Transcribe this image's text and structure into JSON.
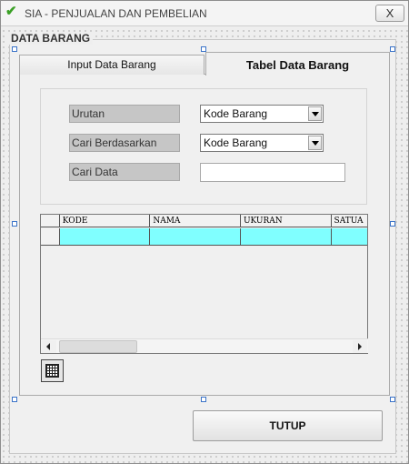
{
  "window": {
    "title": "SIA - PENJUALAN DAN PEMBELIAN",
    "title_icon": "checkmark-icon",
    "close_label": "X"
  },
  "frame": {
    "legend": "DATA BARANG"
  },
  "tabs": [
    {
      "label": "Input Data Barang",
      "selected": false
    },
    {
      "label": "Tabel Data Barang",
      "selected": true
    }
  ],
  "criteria": {
    "urutan_label": "Urutan",
    "urutan_value": "Kode Barang",
    "cari_berdasarkan_label": "Cari Berdasarkan",
    "cari_berdasarkan_value": "Kode Barang",
    "cari_data_label": "Cari Data",
    "cari_data_value": ""
  },
  "grid": {
    "columns": [
      "KODE",
      "NAMA",
      "UKURAN",
      "SATUA"
    ],
    "row_color": "#80ffff"
  },
  "buttons": {
    "tutup": "TUTUP"
  }
}
